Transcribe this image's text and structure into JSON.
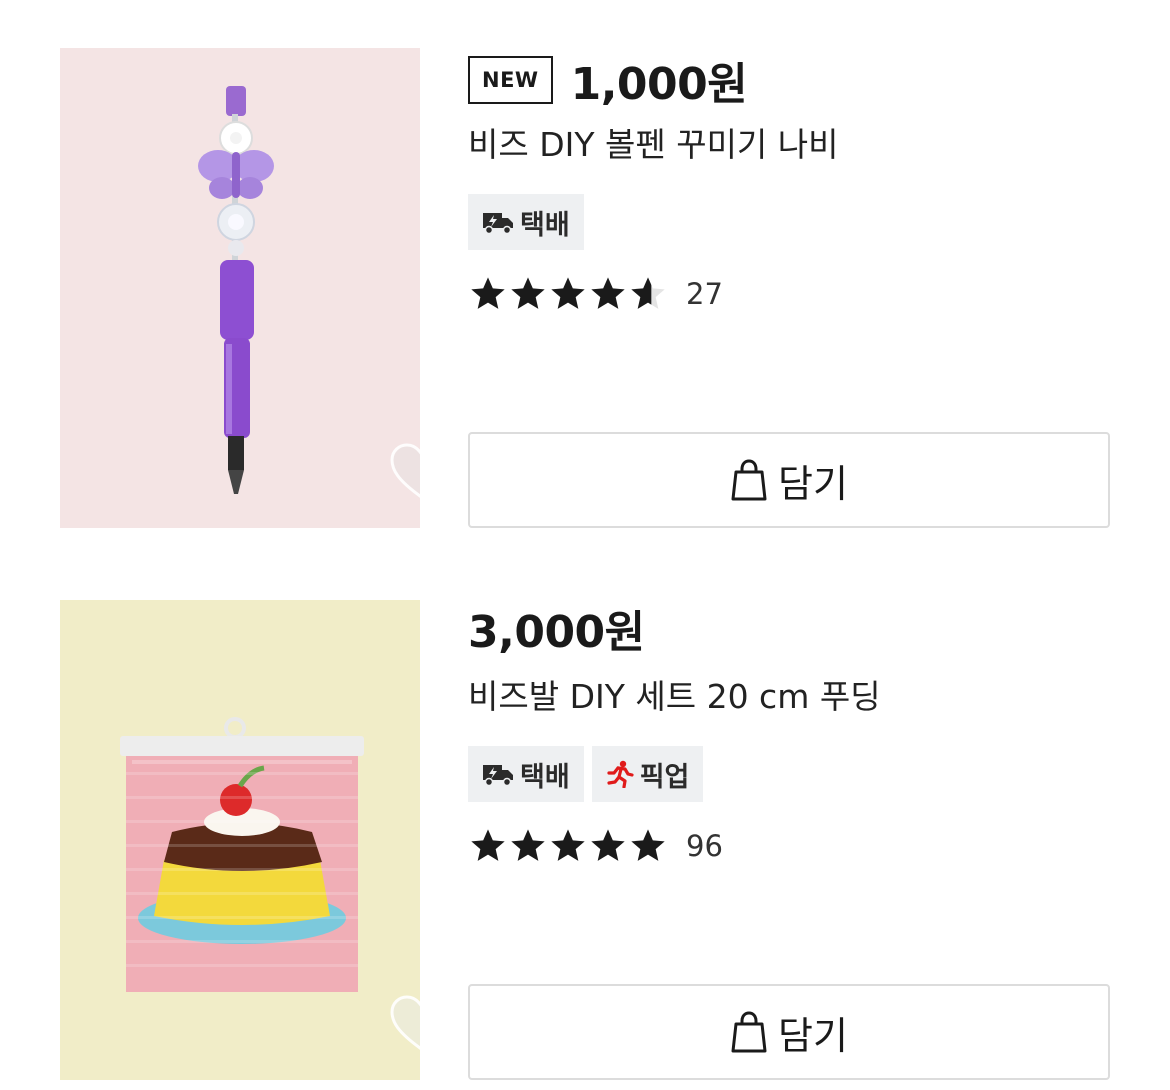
{
  "products": [
    {
      "new_badge": "NEW",
      "price": "1,000원",
      "name": "비즈 DIY 볼펜 꾸미기 나비",
      "badges": [
        {
          "label": "택배",
          "icon": "delivery-truck-icon"
        }
      ],
      "rating": 4.5,
      "review_count": "27",
      "cart_label": "담기",
      "image_bg": "#f4e4e4"
    },
    {
      "price": "3,000원",
      "name": "비즈발 DIY 세트 20 cm 푸딩",
      "badges": [
        {
          "label": "택배",
          "icon": "delivery-truck-icon"
        },
        {
          "label": "픽업",
          "icon": "running-person-icon"
        }
      ],
      "rating": 5,
      "review_count": "96",
      "cart_label": "담기",
      "image_bg": "#f1edc8"
    }
  ],
  "colors": {
    "star": "#1a1a1a",
    "badge_bg": "#eef0f2",
    "pickup_icon": "#e01b1b",
    "border": "#dcdcdc"
  }
}
